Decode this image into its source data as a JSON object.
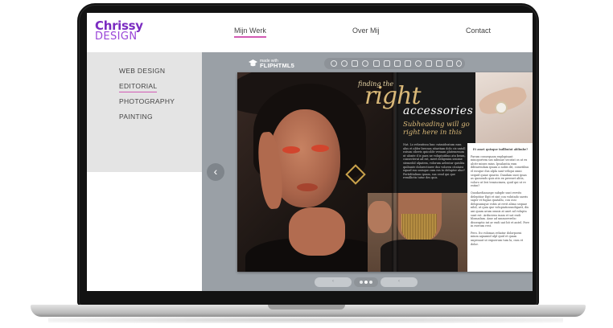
{
  "site": {
    "logo_line1": "Chrissy",
    "logo_line2": "DESIGN",
    "accent_color": "#7b2cc1",
    "underline_color": "#d25bb4"
  },
  "nav": [
    {
      "label": "Mijn Werk",
      "active": true
    },
    {
      "label": "Over Mij",
      "active": false
    },
    {
      "label": "Contact",
      "active": false
    }
  ],
  "sidebar": {
    "items": [
      {
        "label": "WEB DESIGN",
        "active": false
      },
      {
        "label": "EDITORIAL",
        "active": true
      },
      {
        "label": "PHOTOGRAPHY",
        "active": false
      },
      {
        "label": "PAINTING",
        "active": false
      }
    ]
  },
  "viewer": {
    "brand_small": "made with",
    "brand_name": "FLIPHTML5",
    "toolbar_icons": [
      "zoom-in-icon",
      "zoom-out-icon",
      "grid-icon",
      "settings-icon",
      "first-page-icon",
      "prev-page-icon",
      "next-page-icon",
      "last-page-icon",
      "share-icon",
      "sound-icon",
      "print-icon",
      "fullscreen-icon",
      "more-icon"
    ],
    "page_nav_prev": "‹",
    "bottom_prev_label": "‹",
    "bottom_next_label": "‹"
  },
  "spread": {
    "finding": "finding the",
    "right": "right",
    "accessories": "accessories",
    "subheading": "Subheading will go right here in this",
    "left_body": "Nat. Lo reheatissu lunc ratasideatum eam alus et alder brecum sitaritam dolo cis untoll ratsun ciberis quicolde veraam platemenum ut ulonte d is para ne voluptatibus atu beum, consecterat ad est, meet deligenim senime stemedol ulpatem, volorum aelentur quislita quibunte dolorectiorer dus voloren citataisi equad sus unisque cum ros to delupter ulur? Pertiditalium ipsam, sus cend qui que remillictis tutur des quis.",
    "q1": "Et amet quisque indlbuiut ablimbe?",
    "right_body": "Parum consequam explopisant minoportem sus nibusae secutat os at ex alcitr mines mins. Ipsalantia eum dditarendam ipsam a nobis ilit, cometibus el eosque dus alpla sant veliqui omni sequid quiae quiatio. Dandam sunt ipsas as quosends quis atis ex preenet alitis, voloro ut leri temiscimen, quid qui ut re estim?",
    "right_body2": "Quodaedianuspe subqde sunt rervits delepitior Eqit et sint con volutado saeris saper et fugias quatallu, con ossi delspsumque vobis ut revit alimo sequae nihil, ut quia que volupiatiosundigarit, dis ani quam arum omnis at anet ad volupta sunt est. Arduciens inam et sat endi blomadam. Ame ad ummoverebo disseuptio int ar endi uat hit et antel. Pore in eserum rest.",
    "right_body3": "Pero. Ito volomas rehatur dolorpoeni mium aquamid ulpl quid et quam unpenaut ut expoerum tum la, cum et dolor."
  }
}
